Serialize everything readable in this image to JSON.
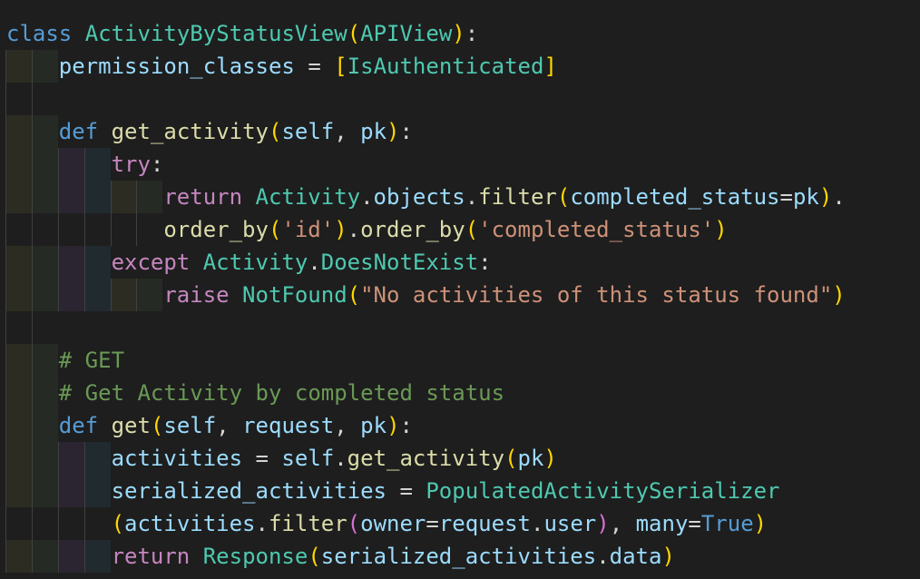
{
  "editor": {
    "lines": [
      {
        "indent": 0,
        "fill": true,
        "tokens": [
          [
            "kw",
            "class"
          ],
          [
            "p",
            " "
          ],
          [
            "cls",
            "ActivityByStatusView"
          ],
          [
            "b1",
            "("
          ],
          [
            "cls",
            "APIView"
          ],
          [
            "b1",
            ")"
          ],
          [
            "p",
            ":"
          ]
        ]
      },
      {
        "indent": 2,
        "fill": true,
        "tokens": [
          [
            "var",
            "permission_classes"
          ],
          [
            "p",
            " = "
          ],
          [
            "b1",
            "["
          ],
          [
            "cls",
            "IsAuthenticated"
          ],
          [
            "b1",
            "]"
          ]
        ]
      },
      {
        "indent": 2,
        "fill": false,
        "tokens": []
      },
      {
        "indent": 2,
        "fill": true,
        "tokens": [
          [
            "kw",
            "def"
          ],
          [
            "p",
            " "
          ],
          [
            "fn",
            "get_activity"
          ],
          [
            "b1",
            "("
          ],
          [
            "var",
            "self"
          ],
          [
            "p",
            ", "
          ],
          [
            "var",
            "pk"
          ],
          [
            "b1",
            ")"
          ],
          [
            "p",
            ":"
          ]
        ]
      },
      {
        "indent": 4,
        "fill": true,
        "tokens": [
          [
            "ctl",
            "try"
          ],
          [
            "p",
            ":"
          ]
        ]
      },
      {
        "indent": 6,
        "fill": true,
        "tokens": [
          [
            "ctl",
            "return"
          ],
          [
            "p",
            " "
          ],
          [
            "cls",
            "Activity"
          ],
          [
            "p",
            "."
          ],
          [
            "var",
            "objects"
          ],
          [
            "p",
            "."
          ],
          [
            "fn",
            "filter"
          ],
          [
            "b1",
            "("
          ],
          [
            "var",
            "completed_status"
          ],
          [
            "p",
            "="
          ],
          [
            "var",
            "pk"
          ],
          [
            "b1",
            ")"
          ],
          [
            "p",
            "."
          ]
        ]
      },
      {
        "indent": 6,
        "fill": false,
        "tokens": [
          [
            "fn",
            "order_by"
          ],
          [
            "b1",
            "("
          ],
          [
            "str",
            "'id'"
          ],
          [
            "b1",
            ")"
          ],
          [
            "p",
            "."
          ],
          [
            "fn",
            "order_by"
          ],
          [
            "b1",
            "("
          ],
          [
            "str",
            "'completed_status'"
          ],
          [
            "b1",
            ")"
          ]
        ]
      },
      {
        "indent": 4,
        "fill": true,
        "tokens": [
          [
            "ctl",
            "except"
          ],
          [
            "p",
            " "
          ],
          [
            "cls",
            "Activity"
          ],
          [
            "p",
            "."
          ],
          [
            "cls",
            "DoesNotExist"
          ],
          [
            "p",
            ":"
          ]
        ]
      },
      {
        "indent": 6,
        "fill": true,
        "tokens": [
          [
            "ctl",
            "raise"
          ],
          [
            "p",
            " "
          ],
          [
            "cls",
            "NotFound"
          ],
          [
            "b1",
            "("
          ],
          [
            "str",
            "\"No activities of this status found\""
          ],
          [
            "b1",
            ")"
          ]
        ]
      },
      {
        "indent": 2,
        "fill": false,
        "tokens": []
      },
      {
        "indent": 2,
        "fill": true,
        "tokens": [
          [
            "com",
            "# GET"
          ]
        ]
      },
      {
        "indent": 2,
        "fill": true,
        "tokens": [
          [
            "com",
            "# Get Activity by completed status"
          ]
        ]
      },
      {
        "indent": 2,
        "fill": true,
        "tokens": [
          [
            "kw",
            "def"
          ],
          [
            "p",
            " "
          ],
          [
            "fn",
            "get"
          ],
          [
            "b1",
            "("
          ],
          [
            "var",
            "self"
          ],
          [
            "p",
            ", "
          ],
          [
            "var",
            "request"
          ],
          [
            "p",
            ", "
          ],
          [
            "var",
            "pk"
          ],
          [
            "b1",
            ")"
          ],
          [
            "p",
            ":"
          ]
        ]
      },
      {
        "indent": 4,
        "fill": true,
        "tokens": [
          [
            "var",
            "activities"
          ],
          [
            "p",
            " = "
          ],
          [
            "var",
            "self"
          ],
          [
            "p",
            "."
          ],
          [
            "fn",
            "get_activity"
          ],
          [
            "b1",
            "("
          ],
          [
            "var",
            "pk"
          ],
          [
            "b1",
            ")"
          ]
        ]
      },
      {
        "indent": 4,
        "fill": true,
        "tokens": [
          [
            "var",
            "serialized_activities"
          ],
          [
            "p",
            " = "
          ],
          [
            "cls",
            "PopulatedActivitySerializer"
          ]
        ]
      },
      {
        "indent": 4,
        "fill": false,
        "tokens": [
          [
            "b1",
            "("
          ],
          [
            "var",
            "activities"
          ],
          [
            "p",
            "."
          ],
          [
            "fn",
            "filter"
          ],
          [
            "b2",
            "("
          ],
          [
            "var",
            "owner"
          ],
          [
            "p",
            "="
          ],
          [
            "var",
            "request"
          ],
          [
            "p",
            "."
          ],
          [
            "var",
            "user"
          ],
          [
            "b2",
            ")"
          ],
          [
            "p",
            ", "
          ],
          [
            "var",
            "many"
          ],
          [
            "p",
            "="
          ],
          [
            "kw",
            "True"
          ],
          [
            "b1",
            ")"
          ]
        ]
      },
      {
        "indent": 4,
        "fill": true,
        "tokens": [
          [
            "ctl",
            "return"
          ],
          [
            "p",
            " "
          ],
          [
            "cls",
            "Response"
          ],
          [
            "b1",
            "("
          ],
          [
            "var",
            "serialized_activities"
          ],
          [
            "p",
            "."
          ],
          [
            "var",
            "data"
          ],
          [
            "b1",
            ")"
          ]
        ]
      }
    ]
  }
}
